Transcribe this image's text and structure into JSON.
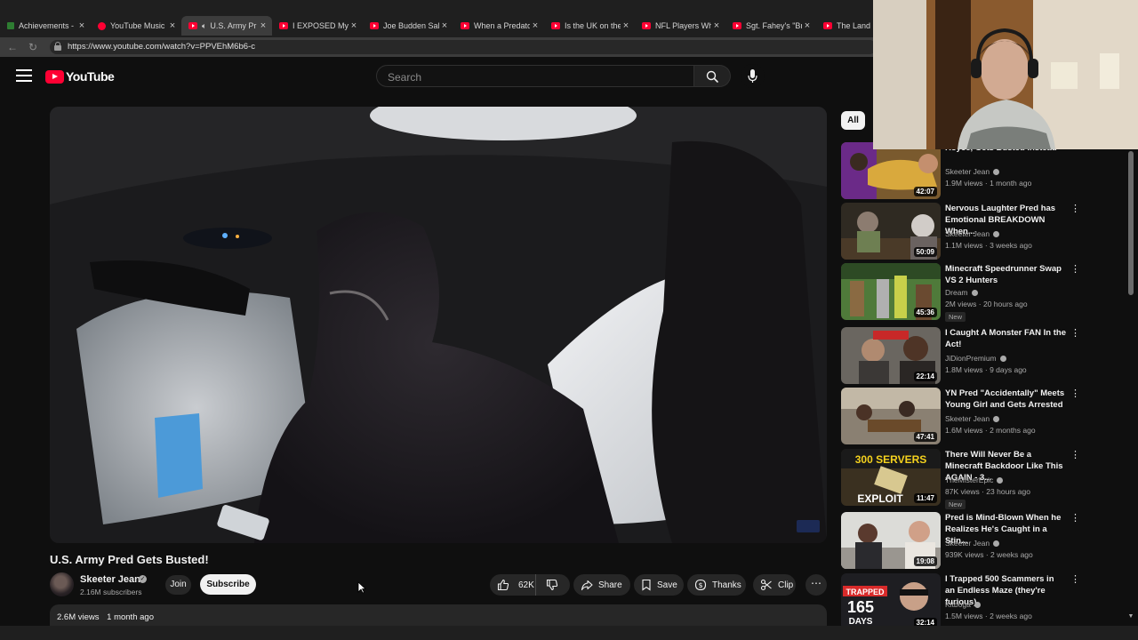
{
  "browser": {
    "tabs": [
      {
        "title": "Achievements - R",
        "icon": "achievements-favicon",
        "active": false
      },
      {
        "title": "YouTube Music",
        "icon": "youtube-music-favicon",
        "active": false
      },
      {
        "title": "U.S. Army Pr",
        "icon": "youtube-favicon",
        "active": true,
        "audio": true
      },
      {
        "title": "I EXPOSED My Bo",
        "icon": "youtube-favicon",
        "active": false
      },
      {
        "title": "Joe Budden Salut",
        "icon": "youtube-favicon",
        "active": false
      },
      {
        "title": "When a Predator",
        "icon": "youtube-favicon",
        "active": false
      },
      {
        "title": "Is the UK on the",
        "icon": "youtube-favicon",
        "active": false
      },
      {
        "title": "NFL Players Who",
        "icon": "youtube-favicon",
        "active": false
      },
      {
        "title": "Sgt. Fahey's \"Bro",
        "icon": "youtube-favicon",
        "active": false
      },
      {
        "title": "The Land",
        "icon": "youtube-favicon",
        "active": false
      }
    ],
    "url": "https://www.youtube.com/watch?v=PPVEhM6b6-c"
  },
  "header": {
    "logo_text": "YouTube",
    "search_placeholder": "Search"
  },
  "video": {
    "title": "U.S. Army Pred Gets Busted!",
    "channel": "Skeeter Jean",
    "subscribers": "2.16M subscribers",
    "join_label": "Join",
    "subscribe_label": "Subscribe",
    "likes": "62K",
    "share_label": "Share",
    "save_label": "Save",
    "thanks_label": "Thanks",
    "clip_label": "Clip",
    "views": "2.6M views",
    "posted": "1 month ago"
  },
  "sidebar": {
    "chip_all": "All",
    "recommendations": [
      {
        "title": "Royce, Gets Busted Instead",
        "channel": "Skeeter Jean",
        "verified": true,
        "meta": "1.9M views · 1 month ago",
        "duration": "42:07",
        "new": false
      },
      {
        "title": "Nervous Laughter Pred has Emotional BREAKDOWN When...",
        "channel": "Skeeter Jean",
        "verified": true,
        "meta": "1.1M views · 3 weeks ago",
        "duration": "50:09",
        "new": false
      },
      {
        "title": "Minecraft Speedrunner Swap VS 2 Hunters",
        "channel": "Dream",
        "verified": true,
        "meta": "2M views · 20 hours ago",
        "duration": "45:36",
        "new": true,
        "new_label": "New"
      },
      {
        "title": "I Caught A Monster FAN In the Act!",
        "channel": "JiDionPremium",
        "verified": true,
        "meta": "1.8M views · 9 days ago",
        "duration": "22:14",
        "new": false
      },
      {
        "title": "YN Pred \"Accidentally\" Meets Young Girl and Gets Arrested",
        "channel": "Skeeter Jean",
        "verified": true,
        "meta": "1.6M views · 2 months ago",
        "duration": "47:41",
        "new": false
      },
      {
        "title": "There Will Never Be a Minecraft Backdoor Like This AGAIN - 3...",
        "channel": "TheMisterEpic",
        "verified": true,
        "meta": "87K views · 23 hours ago",
        "duration": "11:47",
        "new": true,
        "new_label": "New",
        "thumb_text_1": "300 SERVERS",
        "thumb_text_2": "EXPLOIT"
      },
      {
        "title": "Pred is Mind-Blown When he Realizes He's Caught in a Stin...",
        "channel": "Skeeter Jean",
        "verified": true,
        "meta": "939K views · 2 weeks ago",
        "duration": "19:08",
        "new": false
      },
      {
        "title": "I Trapped 500 Scammers in an Endless Maze (they're furious)",
        "channel": "Kitboga",
        "verified": true,
        "meta": "1.5M views · 2 weeks ago",
        "duration": "32:14",
        "new": false,
        "thumb_text_1": "TRAPPED",
        "thumb_text_2": "165",
        "thumb_text_3": "DAYS"
      }
    ]
  },
  "colors": {
    "background": "#0f0f0f",
    "brand_red": "#ff0033",
    "chip_bg": "#272727",
    "text_primary": "#f1f1f1",
    "text_secondary": "#aaaaaa"
  }
}
